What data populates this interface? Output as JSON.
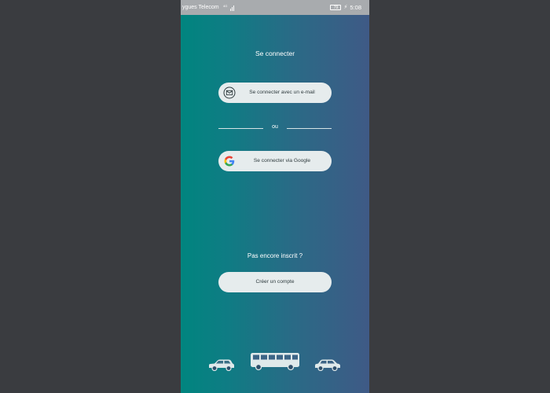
{
  "status_bar": {
    "carrier": "ygues Telecom",
    "network": "4G",
    "battery": "79",
    "time": "5:08"
  },
  "screen": {
    "title": "Se connecter",
    "email_button_label": "Se connecter avec un e-mail",
    "separator": "ou",
    "google_button_label": "Se connecter via Google",
    "signup_prompt": "Pas encore inscrit ?",
    "create_account_label": "Créer un compte"
  },
  "icons": {
    "email": "envelope-icon",
    "google": "google-logo-icon",
    "vehicles": [
      "car-icon",
      "bus-icon",
      "car-icon"
    ]
  },
  "colors": {
    "gradient_start": "#00857f",
    "gradient_end": "#3f5a86",
    "button_bg": "#e6eced",
    "status_bar_bg": "#a8abae",
    "vehicle_fill": "#dfe9ea"
  }
}
